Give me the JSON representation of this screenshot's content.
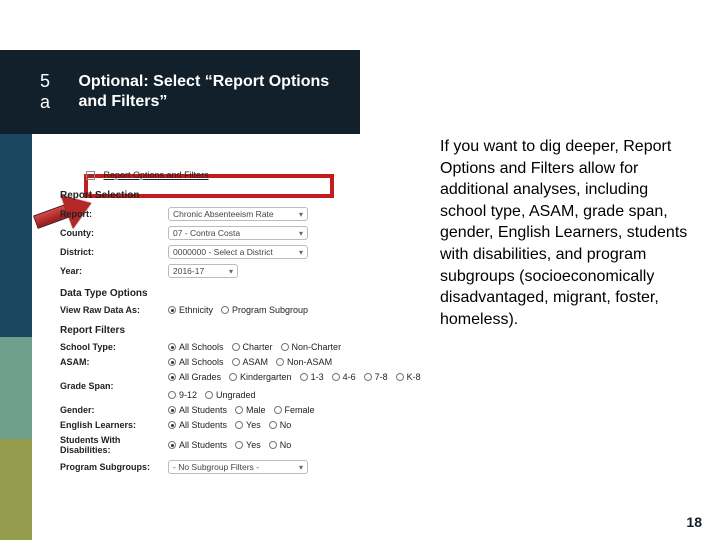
{
  "step_label": "5 a",
  "title": "Optional: Select “Report Options and Filters”",
  "body_text": "If you want to dig deeper, Report Options and Filters allow for additional analyses, including school type, ASAM,  grade span, gender, English Learners, students with disabilities, and program subgroups (socioeconomically disadvantaged, migrant, foster, homeless).",
  "page_number": "18",
  "screenshot": {
    "minus": "−",
    "section_link": "Report Options and Filters",
    "section_report_selection": "Report Selection",
    "section_data_type": "Data Type Options",
    "section_report_filters": "Report Filters",
    "fields": {
      "report": {
        "label": "Report:",
        "value": "Chronic Absenteeism Rate"
      },
      "county": {
        "label": "County:",
        "value": "07 - Contra Costa"
      },
      "district": {
        "label": "District:",
        "value": "0000000 - Select a District"
      },
      "year": {
        "label": "Year:",
        "value": "2016-17"
      },
      "view_raw": {
        "label": "View Raw Data As:"
      },
      "school_type": {
        "label": "School Type:"
      },
      "asam": {
        "label": "ASAM:"
      },
      "grade_span": {
        "label": "Grade Span:"
      },
      "gender": {
        "label": "Gender:"
      },
      "el": {
        "label": "English Learners:"
      },
      "swd": {
        "label": "Students With Disabilities:"
      },
      "program": {
        "label": "Program Subgroups:",
        "value": "- No Subgroup Filters -"
      }
    },
    "radios": {
      "view_raw": [
        {
          "t": "Ethnicity",
          "on": true
        },
        {
          "t": "Program Subgroup",
          "on": false
        }
      ],
      "school_type": [
        {
          "t": "All Schools",
          "on": true
        },
        {
          "t": "Charter",
          "on": false
        },
        {
          "t": "Non-Charter",
          "on": false
        }
      ],
      "asam": [
        {
          "t": "All Schools",
          "on": true
        },
        {
          "t": "ASAM",
          "on": false
        },
        {
          "t": "Non-ASAM",
          "on": false
        }
      ],
      "grade_span": [
        {
          "t": "All Grades",
          "on": true
        },
        {
          "t": "Kindergarten",
          "on": false
        },
        {
          "t": "1-3",
          "on": false
        },
        {
          "t": "4-6",
          "on": false
        },
        {
          "t": "7-8",
          "on": false
        },
        {
          "t": "K-8",
          "on": false
        },
        {
          "t": "9-12",
          "on": false
        },
        {
          "t": "Ungraded",
          "on": false
        }
      ],
      "gender": [
        {
          "t": "All Students",
          "on": true
        },
        {
          "t": "Male",
          "on": false
        },
        {
          "t": "Female",
          "on": false
        }
      ],
      "el": [
        {
          "t": "All Students",
          "on": true
        },
        {
          "t": "Yes",
          "on": false
        },
        {
          "t": "No",
          "on": false
        }
      ],
      "swd": [
        {
          "t": "All Students",
          "on": true
        },
        {
          "t": "Yes",
          "on": false
        },
        {
          "t": "No",
          "on": false
        }
      ]
    }
  }
}
